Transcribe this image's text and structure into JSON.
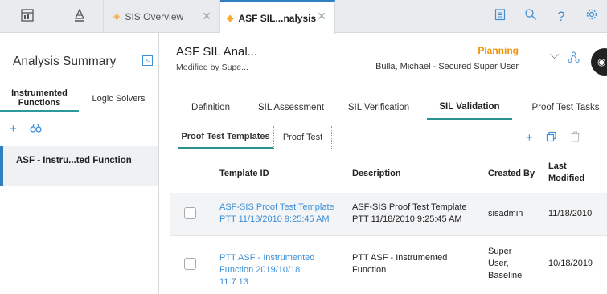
{
  "toolbar": {
    "home_icon": "dashboard-icon",
    "hierarchy_icon": "asset-hierarchy-icon"
  },
  "tabs": [
    {
      "label": "SIS Overview",
      "active": false
    },
    {
      "label": "ASF SIL...nalysis",
      "active": true
    }
  ],
  "top_right_icons": [
    "clipboard-icon",
    "search-icon",
    "help-icon",
    "gear-icon"
  ],
  "left_panel": {
    "title": "Analysis Summary",
    "tabs": [
      {
        "label": "Instrumented Functions",
        "active": true
      },
      {
        "label": "Logic Solvers",
        "active": false
      }
    ],
    "selected_item": "ASF - Instru...ted Function"
  },
  "header": {
    "title": "ASF SIL Anal...",
    "subtitle": "Modified by Supe...",
    "status": "Planning",
    "user": "Bulla, Michael - Secured Super User"
  },
  "main_tabs": [
    {
      "label": "Definition",
      "active": false
    },
    {
      "label": "SIL Assessment",
      "active": false
    },
    {
      "label": "SIL Verification",
      "active": false
    },
    {
      "label": "SIL Validation",
      "active": true
    },
    {
      "label": "Proof Test Tasks",
      "active": false
    }
  ],
  "sub_tabs": [
    {
      "label": "Proof Test Templates",
      "active": true
    },
    {
      "label": "Proof Test",
      "active": false
    }
  ],
  "grid": {
    "columns": {
      "template_id": "Template ID",
      "description": "Description",
      "created_by": "Created By",
      "last_modified": "Last Modified"
    },
    "rows": [
      {
        "template_id": "ASF-SIS Proof Test Template PTT 11/18/2010 9:25:45 AM",
        "description": "ASF-SIS Proof Test Template PTT 11/18/2010 9:25:45 AM",
        "created_by": "sisadmin",
        "last_modified": "11/18/2010"
      },
      {
        "template_id": "PTT ASF - Instrumented Function 2019/10/18 11:7:13",
        "description": "PTT ASF - Instrumented Function",
        "created_by": "Super User, Baseline",
        "last_modified": "10/18/2019"
      }
    ]
  },
  "colors": {
    "accent": "#3d8fd6",
    "active_tab_border": "#2a8f8f",
    "status": "#f0920a"
  }
}
